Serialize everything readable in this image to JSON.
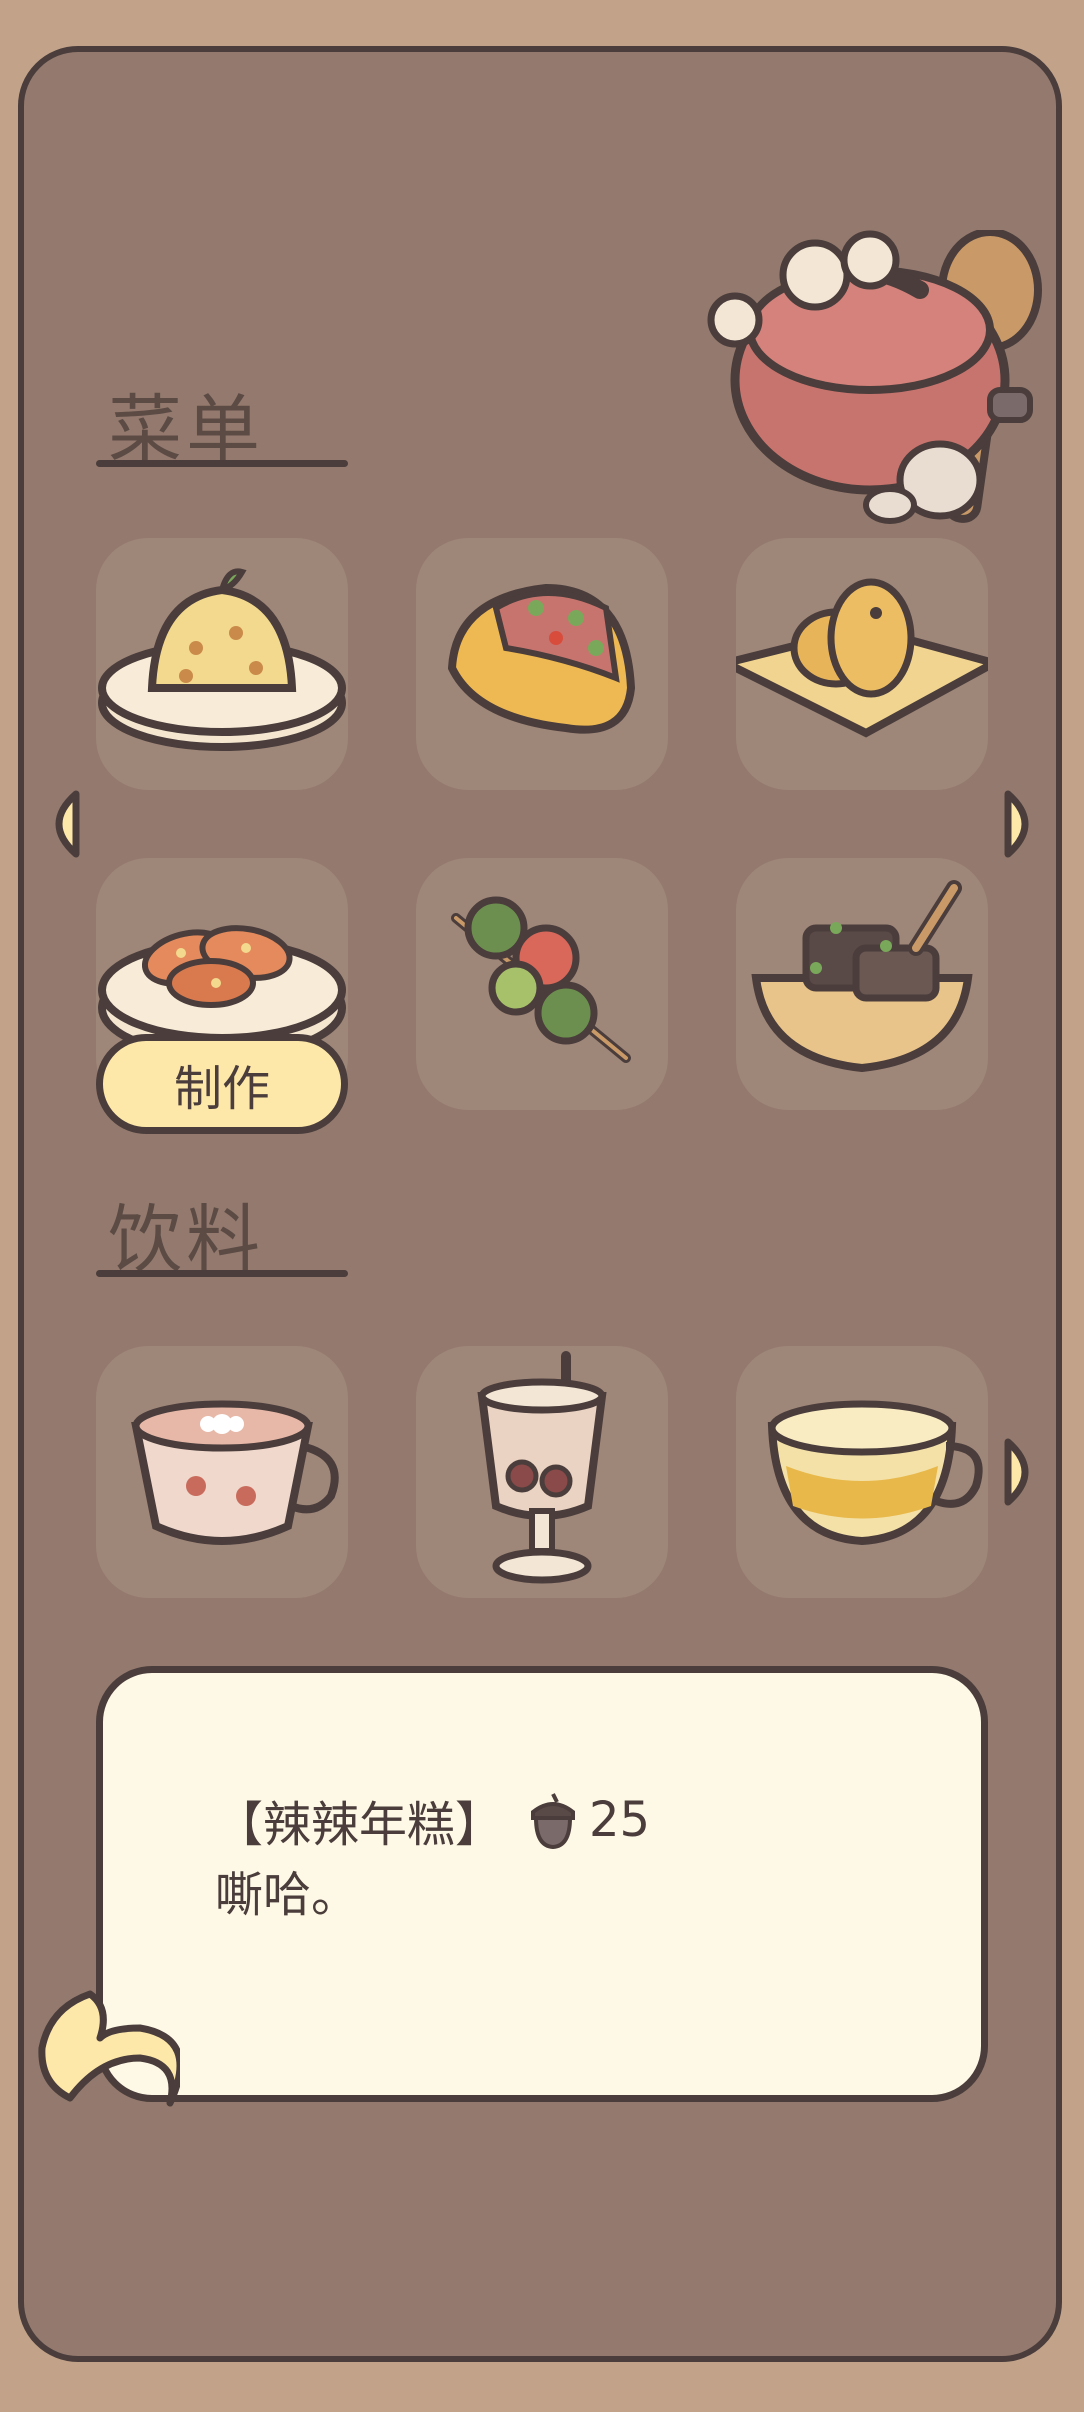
{
  "sections": {
    "menu_title": "菜单",
    "drinks_title": "饮料"
  },
  "menu_items": [
    {
      "icon": "fried-rice-icon"
    },
    {
      "icon": "taco-icon"
    },
    {
      "icon": "taiyaki-icon"
    },
    {
      "icon": "spicy-rice-cake-icon"
    },
    {
      "icon": "skewer-icon"
    },
    {
      "icon": "meat-bowl-icon"
    }
  ],
  "drink_items": [
    {
      "icon": "flower-tea-icon"
    },
    {
      "icon": "berry-drink-icon"
    },
    {
      "icon": "honey-tea-icon"
    }
  ],
  "make_button": "制作",
  "info": {
    "name": "【辣辣年糕】",
    "price": "25",
    "description": "嘶哈。"
  },
  "colors": {
    "background": "#c2a38a",
    "panel": "#947a6e",
    "slot": "#9e8679",
    "button": "#fde8a9",
    "info_box": "#fef9e6",
    "outline": "#4a3d3b"
  }
}
